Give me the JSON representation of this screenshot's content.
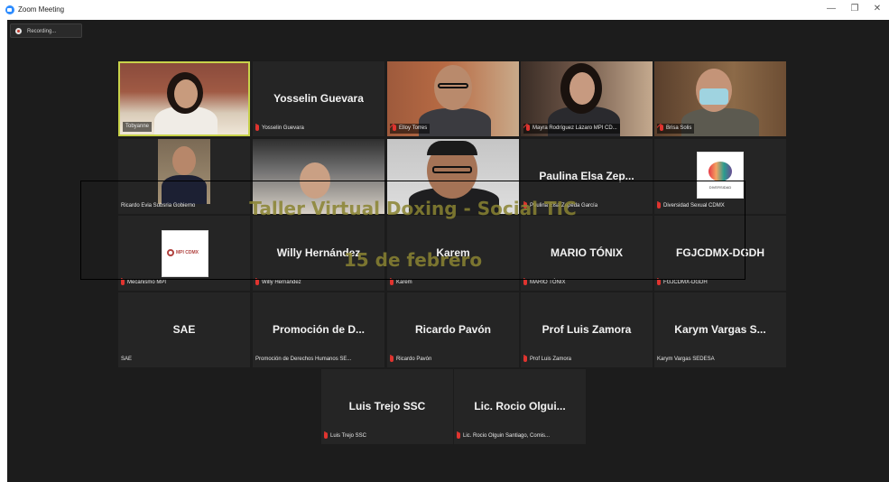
{
  "window": {
    "title": "Zoom Meeting",
    "controls": [
      "—",
      "❐",
      "✕"
    ]
  },
  "recording": {
    "label": "Recording..."
  },
  "overlay": {
    "title": "Taller Virtual Doxing - Social TIC",
    "date": "15 de febrero"
  },
  "participants": [
    {
      "display": "",
      "label": "Tobyanne",
      "muted": false,
      "active": true
    },
    {
      "display": "Yosselin Guevara",
      "label": "Yosselin Guevara",
      "muted": true
    },
    {
      "display": "",
      "label": "Elloy Torres",
      "muted": true
    },
    {
      "display": "",
      "label": "Mayra Rodríguez Lázaro MPI CD...",
      "muted": true
    },
    {
      "display": "",
      "label": "Brisa Solis",
      "muted": true
    },
    {
      "display": "",
      "label": "Ricardo Evia Subsria Gobierno",
      "muted": false
    },
    {
      "display": "",
      "label": "",
      "muted": false
    },
    {
      "display": "",
      "label": "",
      "muted": false
    },
    {
      "display": "Paulina Elsa Zep...",
      "label": "Paulina Elsa Zepeda García",
      "muted": true
    },
    {
      "display": "",
      "label": "Diversidad Sexual CDMX",
      "muted": true
    },
    {
      "display": "",
      "label": "Mecanismo MPI",
      "muted": true
    },
    {
      "display": "Willy Hernández",
      "label": "Willy Hernández",
      "muted": true
    },
    {
      "display": "Karem",
      "label": "Karem",
      "muted": true
    },
    {
      "display": "MARIO TÓNIX",
      "label": "MARIO TÓNIX",
      "muted": true
    },
    {
      "display": "FGJCDMX-DGDH",
      "label": "FGJCDMX-DGDH",
      "muted": true
    },
    {
      "display": "SAE",
      "label": "SAE",
      "muted": false
    },
    {
      "display": "Promoción de D...",
      "label": "Promoción de Derechos Humanos SE...",
      "muted": false
    },
    {
      "display": "Ricardo Pavón",
      "label": "Ricardo Pavón",
      "muted": true
    },
    {
      "display": "Prof Luis Zamora",
      "label": "Prof Luis Zamora",
      "muted": true
    },
    {
      "display": "Karym Vargas S...",
      "label": "Karym Vargas SEDESA",
      "muted": false
    },
    {
      "display": "Luis Trejo SSC",
      "label": "Luis Trejo SSC",
      "muted": true
    },
    {
      "display": "Lic. Rocio Olgui...",
      "label": "Lic. Rocio Olguin Santiago, Comis...",
      "muted": true
    }
  ],
  "logos": {
    "mpi": "MPI CDMX",
    "diversidad": "DIVERSIDAD"
  },
  "colors": {
    "stage": "#1c1c1c",
    "tile": "#252525",
    "active_border": "#c8d24a",
    "muted_icon": "#e0342f",
    "overlay_text": "#8a8432"
  }
}
